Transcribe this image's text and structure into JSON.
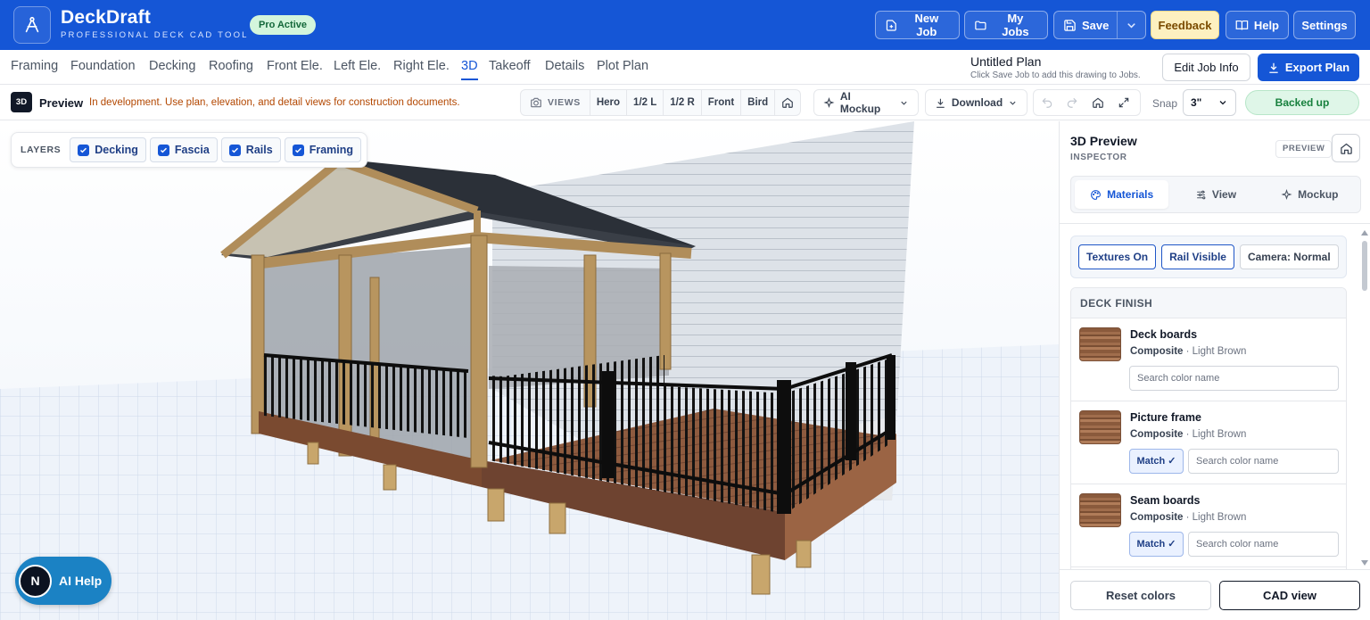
{
  "app": {
    "name": "DeckDraft",
    "tagline": "PROFESSIONAL DECK CAD TOOL",
    "pro_badge": "Pro Active",
    "brand_color": "#1556d6"
  },
  "header_buttons": {
    "new_job": "New Job",
    "my_jobs": "My Jobs",
    "save": "Save",
    "feedback": "Feedback",
    "help": "Help",
    "settings": "Settings"
  },
  "tabs": [
    {
      "label": "Framing"
    },
    {
      "label": "Foundation"
    },
    {
      "label": "Decking"
    },
    {
      "label": "Roofing"
    },
    {
      "label": "Front Ele."
    },
    {
      "label": "Left Ele."
    },
    {
      "label": "Right Ele."
    },
    {
      "label": "3D",
      "active": true
    },
    {
      "label": "Takeoff"
    },
    {
      "label": "Details"
    },
    {
      "label": "Plot Plan"
    }
  ],
  "plan": {
    "title": "Untitled Plan",
    "subtitle": "Click Save Job to add this drawing to Jobs.",
    "edit_job": "Edit Job Info",
    "export": "Export Plan"
  },
  "toolbar": {
    "badge": "3D",
    "preview_label": "Preview",
    "dev_note": "In development. Use plan, elevation, and detail views for construction documents.",
    "views_label": "VIEWS",
    "views": [
      "Hero",
      "1/2 L",
      "1/2 R",
      "Front",
      "Bird"
    ],
    "ai_mockup": "AI Mockup",
    "download": "Download",
    "snap_label": "Snap",
    "snap_value": "3\"",
    "status": "Backed up"
  },
  "layers": {
    "label": "LAYERS",
    "items": [
      {
        "label": "Decking",
        "checked": true
      },
      {
        "label": "Fascia",
        "checked": true
      },
      {
        "label": "Rails",
        "checked": true
      },
      {
        "label": "Framing",
        "checked": true
      }
    ]
  },
  "ai_help": {
    "avatar": "N",
    "label": "AI Help"
  },
  "inspector": {
    "title": "3D Preview",
    "subtitle": "INSPECTOR",
    "badge": "PREVIEW",
    "tabs": [
      "Materials",
      "View",
      "Mockup"
    ],
    "pills": [
      "Textures On",
      "Rail Visible",
      "Camera: Normal"
    ],
    "section": "DECK FINISH",
    "materials": [
      {
        "name": "Deck boards",
        "type": "Composite",
        "color": "Light Brown",
        "placeholder": "Search color name"
      },
      {
        "name": "Picture frame",
        "type": "Composite",
        "color": "Light Brown",
        "match": "Match ✓",
        "placeholder": "Search color name"
      },
      {
        "name": "Seam boards",
        "type": "Composite",
        "color": "Light Brown",
        "match": "Match ✓",
        "placeholder": "Search color name"
      }
    ],
    "reset": "Reset colors",
    "cad_view": "CAD view"
  }
}
